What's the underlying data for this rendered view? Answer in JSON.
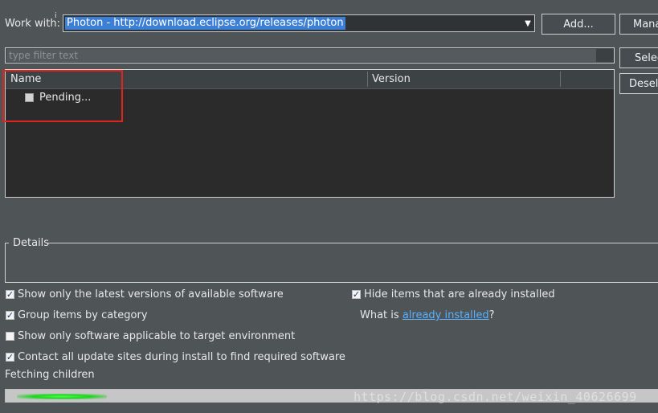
{
  "work_with": {
    "label": "Work with:",
    "info_mark": "i",
    "site_value": "Photon - http://download.eclipse.org/releases/photon",
    "add_label": "Add...",
    "manage_label": "Manage..."
  },
  "filter": {
    "placeholder": "type filter text"
  },
  "side_buttons": {
    "select_all": "Select All",
    "deselect_all": "Deselect All"
  },
  "tree": {
    "columns": [
      "Name",
      "Version"
    ],
    "items": [
      {
        "label": "Pending...",
        "checked": false
      }
    ]
  },
  "details": {
    "label": "Details"
  },
  "options": {
    "latest_versions": {
      "label": "Show only the latest versions of available software",
      "checked": true
    },
    "group_by_category": {
      "label": "Group items by category",
      "checked": true
    },
    "target_environment": {
      "label": "Show only software applicable to target environment",
      "checked": false
    },
    "contact_all_sites": {
      "label": "Contact all update sites during install to find required software",
      "checked": true
    },
    "hide_installed": {
      "label": "Hide items that are already installed",
      "checked": true
    },
    "what_is": {
      "prefix": "What is ",
      "link": "already installed",
      "suffix": "?"
    }
  },
  "status": "Fetching children",
  "watermark": "https://blog.csdn.net/weixin_40626699",
  "colors": {
    "selection": "#3c7fd6",
    "link": "#59b1ff",
    "highlight_box": "#e0231c",
    "progress": "#2bd62b"
  }
}
